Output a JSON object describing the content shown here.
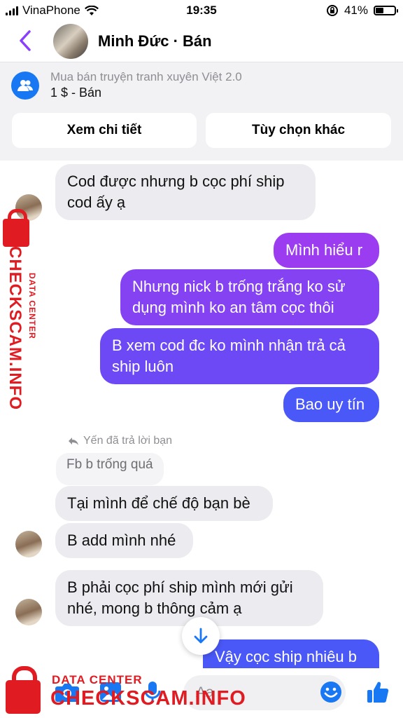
{
  "status": {
    "carrier": "VinaPhone",
    "time": "19:35",
    "battery": "41%"
  },
  "header": {
    "title": "Minh Đức · Bán"
  },
  "listing": {
    "group": "Mua bán truyện tranh xuyên Việt 2.0",
    "price": "1 $ - Bán",
    "details_label": "Xem chi tiết",
    "options_label": "Tùy chọn khác"
  },
  "messages": {
    "m1": "Cod được nhưng b cọc phí ship\ncod ấy ạ",
    "m2": "Mình hiểu r",
    "m3": "Nhưng nick b trống trắng ko sử\ndụng mình ko an tâm cọc thôi",
    "m4": "B xem cod đc ko mình nhận trả cả\nship luôn",
    "m5": "Bao uy tín",
    "reply_note": "Yến đã trả lời bạn",
    "quoted": "Fb b trống quá",
    "m6": "Tại mình để chế độ bạn bè",
    "m7": "B add mình nhé",
    "m8": "B phải cọc phí ship mình mới gửi\nnhé, mong b thông cảm ạ",
    "m9": "Vậy cọc ship nhiêu b"
  },
  "composer": {
    "placeholder": "Aa"
  },
  "watermark": {
    "sub": "DATA CENTER",
    "brand": "CHECKSCAM.INFO"
  },
  "colors": {
    "accent": "#8a3ffc",
    "messenger_blue": "#1877f2",
    "watermark_red": "#e01b22"
  }
}
